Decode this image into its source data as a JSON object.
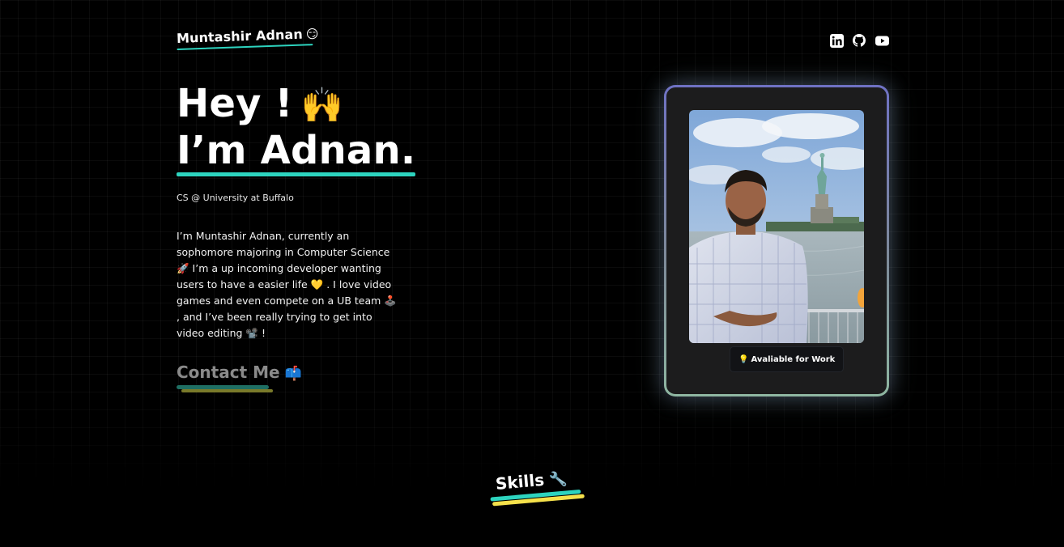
{
  "header": {
    "brand_name": "Muntashir Adnan",
    "brand_emoji": "😏",
    "socials": [
      {
        "name": "linkedin-icon"
      },
      {
        "name": "github-icon"
      },
      {
        "name": "youtube-icon"
      }
    ]
  },
  "hero": {
    "line1": "Hey !",
    "wave_emoji": "🙌",
    "line2": "I’m Adnan.",
    "subtitle": "CS @ University at Buffalo",
    "bio": "I’m Muntashir Adnan, currently an sophomore majoring in Computer Science 🚀 I’m a up incoming developer wanting users to have a easier life 💛 . I love video games and even compete on a UB team 🕹️ , and I’ve been really trying to get into video editing 📽️ !",
    "contact_label": "Contact Me",
    "contact_emoji": "📫",
    "accent_color": "#2dd4bf"
  },
  "card": {
    "badge_icon": "💡",
    "badge_label": "Avaliable for Work",
    "photo_icon": "portrait-photo"
  },
  "skills": {
    "label": "Skills",
    "emoji": "🔧"
  }
}
